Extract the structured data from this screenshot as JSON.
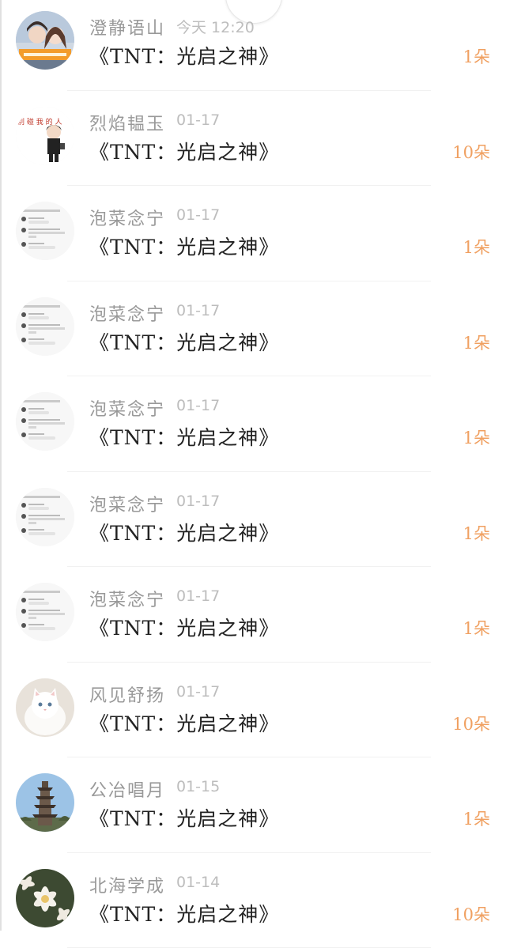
{
  "list": {
    "items": [
      {
        "name": "澄静语山",
        "time": "今天 12:20",
        "title": "《TNT：光启之神》",
        "amount": "1朵",
        "avatar": "couple-photo-avatar"
      },
      {
        "name": "烈焰韫玉",
        "time": "01-17",
        "title": "《TNT：光启之神》",
        "amount": "10朵",
        "avatar": "cartoon-figure-avatar"
      },
      {
        "name": "泡菜念宁",
        "time": "01-17",
        "title": "《TNT：光启之神》",
        "amount": "1朵",
        "avatar": "chat-screenshot-avatar"
      },
      {
        "name": "泡菜念宁",
        "time": "01-17",
        "title": "《TNT：光启之神》",
        "amount": "1朵",
        "avatar": "chat-screenshot-avatar"
      },
      {
        "name": "泡菜念宁",
        "time": "01-17",
        "title": "《TNT：光启之神》",
        "amount": "1朵",
        "avatar": "chat-screenshot-avatar"
      },
      {
        "name": "泡菜念宁",
        "time": "01-17",
        "title": "《TNT：光启之神》",
        "amount": "1朵",
        "avatar": "chat-screenshot-avatar"
      },
      {
        "name": "泡菜念宁",
        "time": "01-17",
        "title": "《TNT：光启之神》",
        "amount": "1朵",
        "avatar": "chat-screenshot-avatar"
      },
      {
        "name": "风见舒扬",
        "time": "01-17",
        "title": "《TNT：光启之神》",
        "amount": "10朵",
        "avatar": "white-cat-avatar"
      },
      {
        "name": "公冶唱月",
        "time": "01-15",
        "title": "《TNT：光启之神》",
        "amount": "1朵",
        "avatar": "pagoda-avatar"
      },
      {
        "name": "北海学成",
        "time": "01-14",
        "title": "《TNT：光启之神》",
        "amount": "10朵",
        "avatar": "white-flowers-avatar"
      }
    ]
  },
  "colors": {
    "name": "#999999",
    "time": "#bdbdbd",
    "title": "#222222",
    "amount": "#f0a061"
  }
}
